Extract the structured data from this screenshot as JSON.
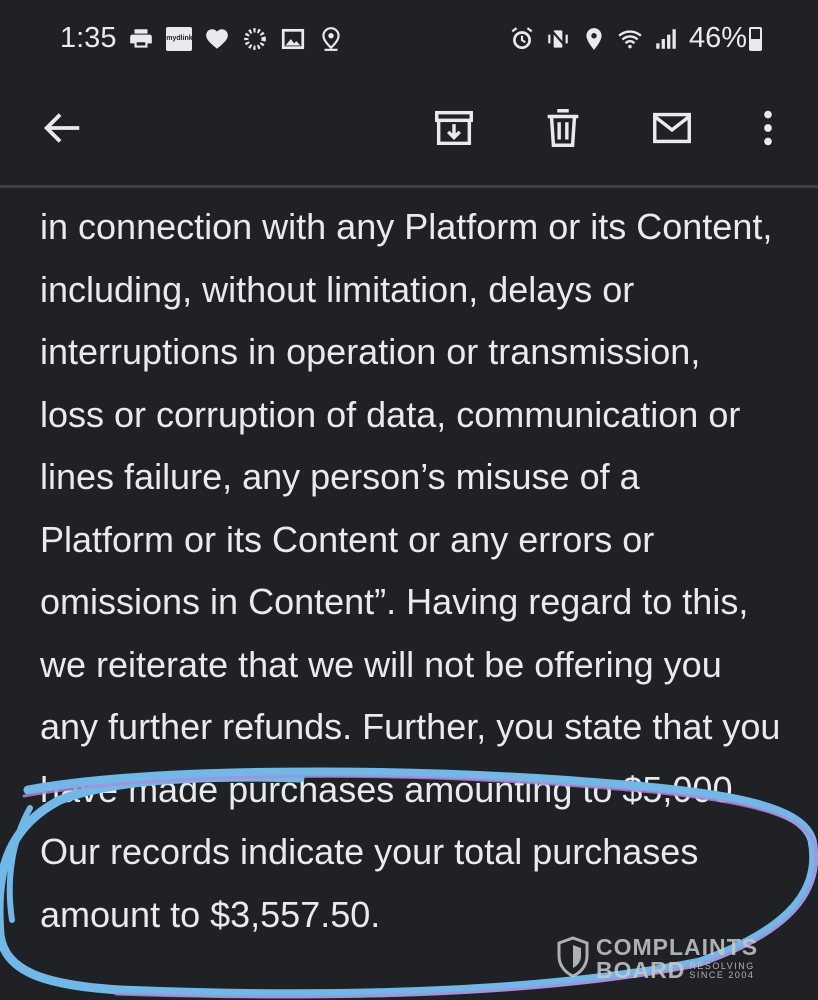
{
  "status_bar": {
    "time": "1:35",
    "battery_percent": "46%",
    "battery_level": 0.46,
    "left_icons": [
      "printer-icon",
      "mydlink-app-icon",
      "heart-icon",
      "sync-progress-icon",
      "image-icon",
      "location-pin-icon"
    ],
    "right_icons": [
      "alarm-icon",
      "vibrate-icon",
      "location-icon",
      "wifi-icon",
      "signal-icon",
      "battery-icon"
    ],
    "mydlink_label": "mydlink"
  },
  "toolbar": {
    "icons": [
      "back-arrow-icon",
      "archive-icon",
      "delete-icon",
      "mail-icon",
      "more-vert-icon"
    ]
  },
  "email": {
    "lines": [
      "in connection with any Platform or its Content,",
      "including, without limitation, delays or",
      "interruptions in operation or transmission,",
      "loss or corruption of data, communication or",
      "lines failure, any person’s misuse of a",
      "Platform or its Content or any errors or",
      "omissions in Content”. Having regard to this,",
      "we reiterate that we will not be offering you",
      "any further refunds. Further, you state that you",
      "have made purchases amounting to $5,000.",
      "Our records indicate your total purchases",
      "amount to $3,557.50."
    ]
  },
  "annotation": {
    "stroke_color": "#6fb8e8",
    "stroke_color_inner": "#b08ad8"
  },
  "watermark": {
    "line1": "COMPLAINTS",
    "line2": "BOARD",
    "tag1": "RESOLVING",
    "tag2": "SINCE 2004"
  },
  "colors": {
    "background": "#202124",
    "text": "#e8eaed",
    "divider": "#3c4043"
  }
}
